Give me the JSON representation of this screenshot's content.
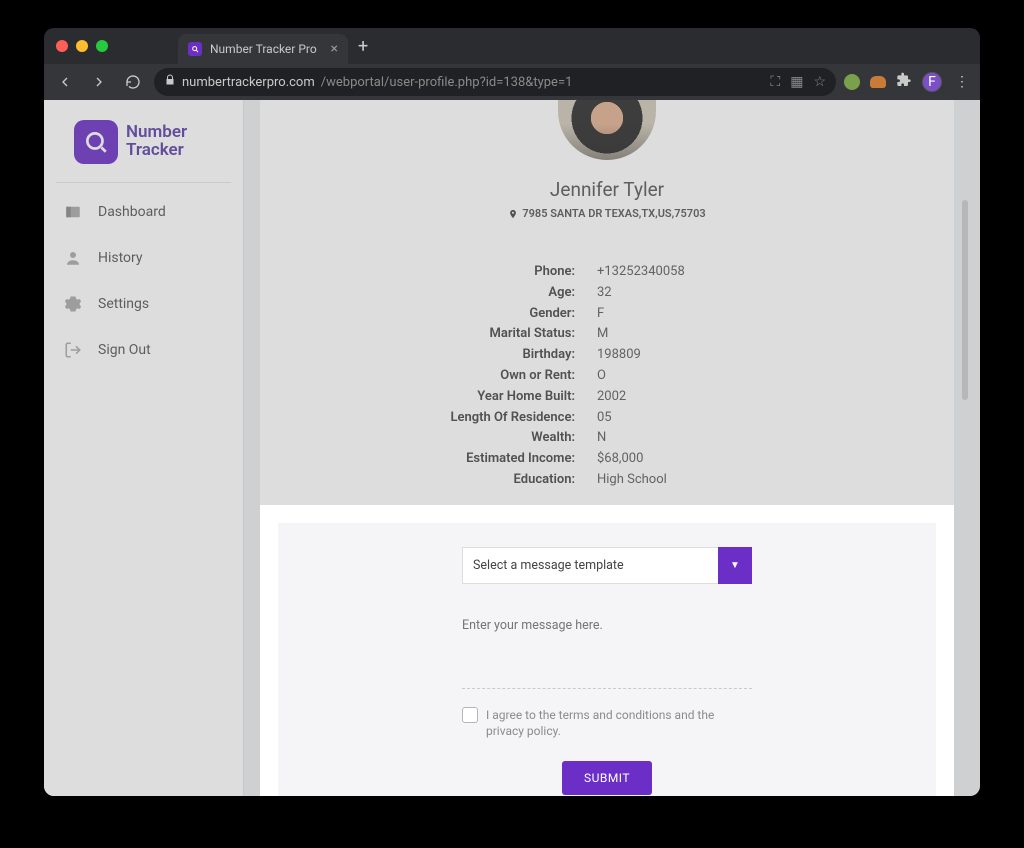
{
  "browser": {
    "tab_title": "Number Tracker Pro",
    "url_display_host": "numbertrackerpro.com",
    "url_display_path": "/webportal/user-profile.php?id=138&type=1",
    "avatar_initial": "F"
  },
  "brand": {
    "line1": "Number",
    "line2": "Tracker"
  },
  "sidebar": {
    "items": [
      {
        "label": "Dashboard"
      },
      {
        "label": "History"
      },
      {
        "label": "Settings"
      },
      {
        "label": "Sign Out"
      }
    ]
  },
  "profile": {
    "name": "Jennifer Tyler",
    "address": "7985 SANTA DR TEXAS,TX,US,75703",
    "details": [
      {
        "label": "Phone:",
        "value": "+13252340058"
      },
      {
        "label": "Age:",
        "value": "32"
      },
      {
        "label": "Gender:",
        "value": "F"
      },
      {
        "label": "Marital Status:",
        "value": "M"
      },
      {
        "label": "Birthday:",
        "value": "198809"
      },
      {
        "label": "Own or Rent:",
        "value": "O"
      },
      {
        "label": "Year Home Built:",
        "value": "2002"
      },
      {
        "label": "Length Of Residence:",
        "value": "05"
      },
      {
        "label": "Wealth:",
        "value": "N"
      },
      {
        "label": "Estimated Income:",
        "value": "$68,000"
      },
      {
        "label": "Education:",
        "value": "High School"
      }
    ]
  },
  "compose": {
    "template_placeholder": "Select a message template",
    "dropdown_glyph": "▼",
    "message_placeholder": "Enter your message here.",
    "terms_text": "I agree to the terms and conditions and the privacy policy.",
    "submit_label": "SUBMIT"
  }
}
